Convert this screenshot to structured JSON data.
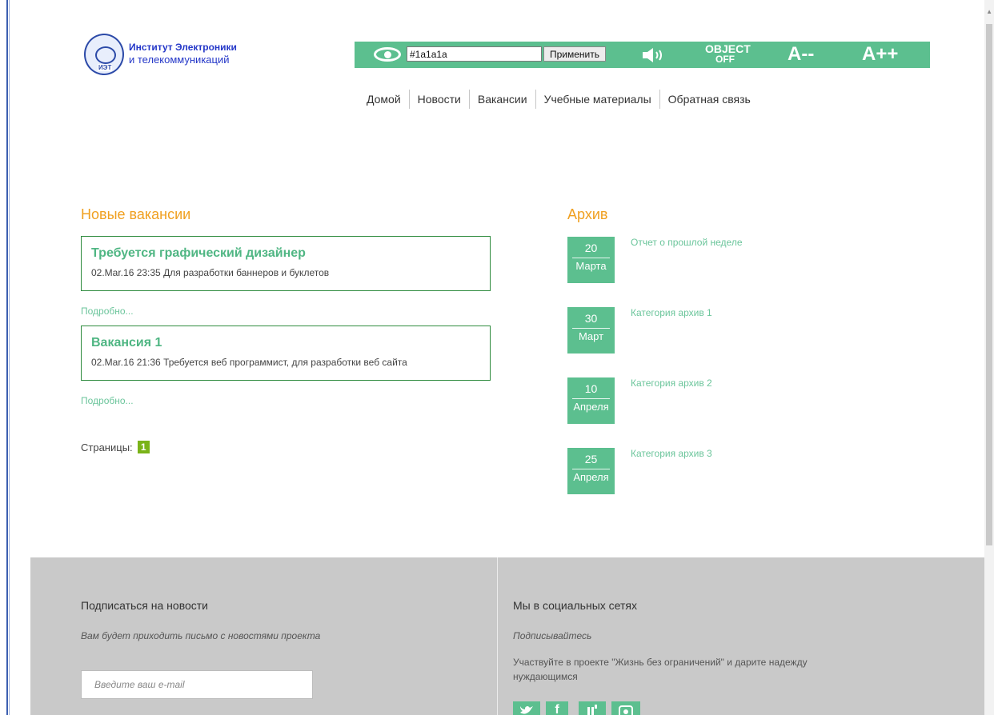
{
  "header": {
    "logo": {
      "line1": "Институт Электроники",
      "line2": "и телекоммуникаций",
      "abbr": "ИЭТ"
    },
    "accessibility": {
      "color_value": "#1a1a1a",
      "apply_label": "Применить",
      "object_label": "OBJECT",
      "object_state": "OFF",
      "font_decrease": "A--",
      "font_increase": "A++"
    },
    "nav": [
      {
        "label": "Домой"
      },
      {
        "label": "Новости"
      },
      {
        "label": "Вакансии"
      },
      {
        "label": "Учебные материалы"
      },
      {
        "label": "Обратная связь"
      }
    ]
  },
  "vacancies": {
    "title": "Новые вакансии",
    "items": [
      {
        "title": "Требуется графический дизайнер",
        "meta": "02.Mar.16 23:35 Для разработки баннеров и буклетов",
        "more": "Подробно..."
      },
      {
        "title": "Вакансия 1",
        "meta": "02.Mar.16 21:36 Требуется веб программист, для разработки веб сайта",
        "more": "Подробно..."
      }
    ],
    "pages_label": "Страницы:",
    "current_page": "1"
  },
  "archive": {
    "title": "Архив",
    "items": [
      {
        "day": "20",
        "month": "Марта",
        "link": "Отчет о прошлой неделе"
      },
      {
        "day": "30",
        "month": "Март",
        "link": "Категория архив 1"
      },
      {
        "day": "10",
        "month": "Апреля",
        "link": "Категория архив 2"
      },
      {
        "day": "25",
        "month": "Апреля",
        "link": "Категория архив 3"
      }
    ]
  },
  "footer": {
    "subscribe": {
      "title": "Подписаться на новости",
      "note": "Вам будет приходить письмо с новостями проекта",
      "email_placeholder": "Введите ваш e-mail"
    },
    "social": {
      "title": "Мы в социальных сетях",
      "subtitle": "Подписывайтесь",
      "text": "Участвуйте в проекте \"Жизнь без ограничений\" и дарите надежду нуждающимся",
      "icons": [
        "twitter-icon",
        "facebook-icon",
        "vk-icon",
        "instagram-icon"
      ]
    }
  },
  "colors": {
    "accent_green": "#5cbf8f",
    "title_orange": "#f0a020",
    "page_badge": "#7ab319"
  }
}
